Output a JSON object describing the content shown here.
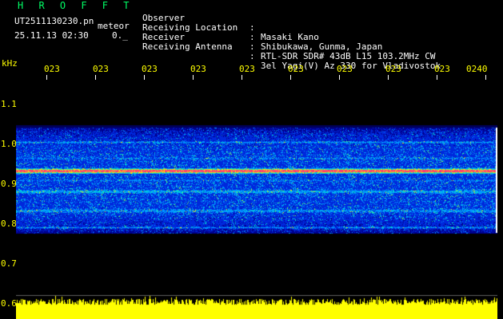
{
  "header": {
    "brand": "HROFFT",
    "filename": "UT2511130230.pn",
    "file_type": "meteor",
    "datetime": "25.11.13 02:30",
    "value": "0._"
  },
  "metadata": [
    {
      "key": "Observer",
      "value": "Masaki Kano"
    },
    {
      "key": "Receiving Location",
      "value": "Shibukawa, Gunma, Japan"
    },
    {
      "key": "Receiver",
      "value": "RTL-SDR SDR# 43dB L15 103.2MHz CW"
    },
    {
      "key": "Receiving Antenna",
      "value": "3el Yagi(V) Az 330 for Vladivostok"
    }
  ],
  "meta_separator": ":",
  "axis": {
    "unit": "kHz",
    "time_labels": [
      "023",
      "023",
      "023",
      "023",
      "023",
      "023",
      "023",
      "023",
      "023",
      "0240"
    ],
    "freq_labels": [
      "1.1",
      "1.0",
      "0.9",
      "0.8",
      "0.7",
      "0.6"
    ]
  },
  "colors": {
    "text_primary": "#ffffff",
    "text_axis": "#ffff00",
    "brand": "#00ff66",
    "noise_bar": "#ffff00",
    "signal_strong": "#ff3366"
  }
}
